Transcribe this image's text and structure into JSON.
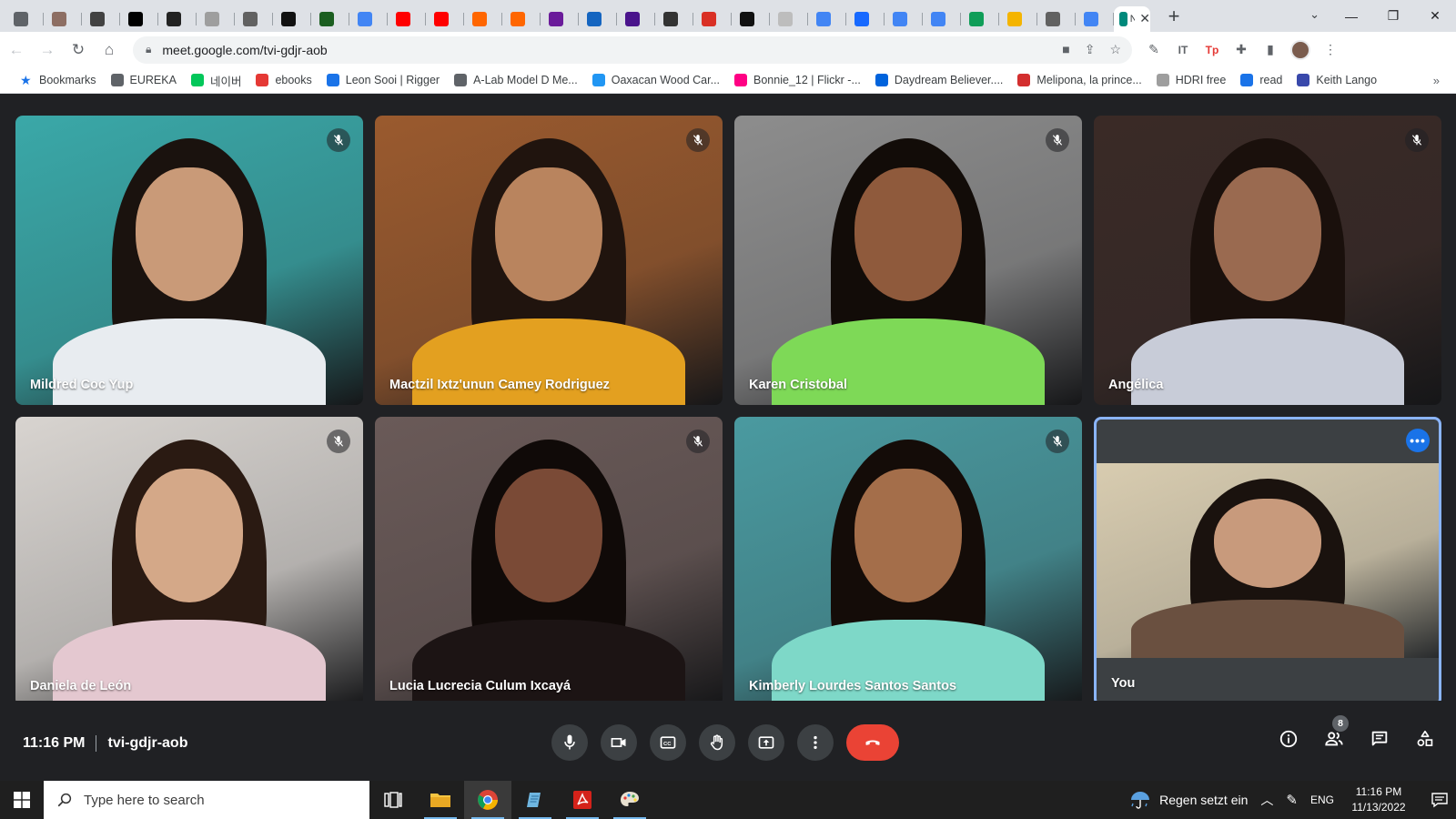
{
  "browser": {
    "tabs": [
      {
        "text": "",
        "color": "#5f6368"
      },
      {
        "text": "",
        "color": "#8d6e63"
      },
      {
        "text": "",
        "color": "#424242"
      },
      {
        "text": "",
        "color": "#000000"
      },
      {
        "text": "",
        "color": "#222222"
      },
      {
        "text": "",
        "color": "#9e9e9e"
      },
      {
        "text": "",
        "color": "#616161"
      },
      {
        "text": "",
        "color": "#111111"
      },
      {
        "text": "",
        "color": "#1b5e20"
      },
      {
        "text": "",
        "color": "#4285f4"
      },
      {
        "text": "",
        "color": "#ff0000"
      },
      {
        "text": "",
        "color": "#ff0000"
      },
      {
        "text": "",
        "color": "#ff6600"
      },
      {
        "text": "",
        "color": "#ff6600"
      },
      {
        "text": "",
        "color": "#6a1b9a"
      },
      {
        "text": "",
        "color": "#1565c0"
      },
      {
        "text": "",
        "color": "#4a148c"
      },
      {
        "text": "",
        "color": "#333333"
      },
      {
        "text": "",
        "color": "#d93025"
      },
      {
        "text": "",
        "color": "#111111"
      },
      {
        "text": "",
        "color": "#bdbdbd"
      },
      {
        "text": "",
        "color": "#4285f4"
      },
      {
        "text": "",
        "color": "#1769ff"
      },
      {
        "text": "",
        "color": "#4285f4"
      },
      {
        "text": "",
        "color": "#4285f4"
      },
      {
        "text": "",
        "color": "#0f9d58"
      },
      {
        "text": "",
        "color": "#f4b400"
      },
      {
        "text": "",
        "color": "#616161"
      },
      {
        "text": "",
        "color": "#4285f4"
      }
    ],
    "active_tab_label": "N",
    "url": "meet.google.com/tvi-gdjr-aob",
    "bookmarks": [
      {
        "label": "Bookmarks",
        "color": "#1a73e8"
      },
      {
        "label": "EUREKA",
        "color": "#5f6368"
      },
      {
        "label": "네이버",
        "color": "#03c75a"
      },
      {
        "label": "ebooks",
        "color": "#e53935"
      },
      {
        "label": "Leon Sooi | Rigger",
        "color": "#1a73e8"
      },
      {
        "label": "A-Lab Model D Me...",
        "color": "#5f6368"
      },
      {
        "label": "Oaxacan Wood Car...",
        "color": "#2196f3"
      },
      {
        "label": "Bonnie_12 | Flickr -...",
        "color": "#ff0084"
      },
      {
        "label": "Daydream Believer....",
        "color": "#0063dc"
      },
      {
        "label": "Melipona, la prince...",
        "color": "#d32f2f"
      },
      {
        "label": "HDRI free",
        "color": "#9e9e9e"
      },
      {
        "label": "read",
        "color": "#1a73e8"
      },
      {
        "label": "Keith Lango",
        "color": "#3949ab"
      }
    ],
    "bookmarks_more": "»"
  },
  "meet": {
    "participants": [
      {
        "name": "Mildred Coc Yup",
        "muted": true,
        "bg": "#3aa8a8",
        "skin": "#c99a78",
        "hair": "#1a120e",
        "shirt": "#e8ecf0"
      },
      {
        "name": "Mactzil Ixtz'unun Camey Rodriguez",
        "muted": true,
        "bg": "#9a5a2e",
        "skin": "#b9845e",
        "hair": "#20140e",
        "shirt": "#e3a020"
      },
      {
        "name": "Karen Cristobal",
        "muted": true,
        "bg": "#8d8d8d",
        "skin": "#8f5a3c",
        "hair": "#120c08",
        "shirt": "#7ed957"
      },
      {
        "name": "Angélica",
        "muted": true,
        "bg": "#3a2a26",
        "skin": "#9a6a50",
        "hair": "#1a100c",
        "shirt": "#c8ccd8"
      },
      {
        "name": "Daniela de León",
        "muted": true,
        "bg": "#d8d4d0",
        "skin": "#d4a888",
        "hair": "#2a1a12",
        "shirt": "#e4c8d0"
      },
      {
        "name": "Lucia Lucrecia Culum Ixcayá",
        "muted": true,
        "bg": "#6a5a58",
        "skin": "#7a4a36",
        "hair": "#100a08",
        "shirt": "#1c1414"
      },
      {
        "name": "Kimberly Lourdes Santos Santos",
        "muted": true,
        "bg": "#4a9aa0",
        "skin": "#a46e4a",
        "hair": "#140c08",
        "shirt": "#7ed8c8"
      },
      {
        "name": "You",
        "muted": false,
        "bg": "#d8ccb0",
        "skin": "#c89a7c",
        "hair": "#1a120e",
        "shirt": "#6a5040"
      }
    ],
    "more_options": "•••",
    "time": "11:16 PM",
    "meeting_code": "tvi-gdjr-aob",
    "people_count": "8",
    "accent": "#8ab4f8",
    "end_call_color": "#ea4335"
  },
  "taskbar": {
    "search_placeholder": "Type here to search",
    "weather": "Regen setzt ein",
    "language": "ENG",
    "time": "11:16 PM",
    "date": "11/13/2022"
  }
}
